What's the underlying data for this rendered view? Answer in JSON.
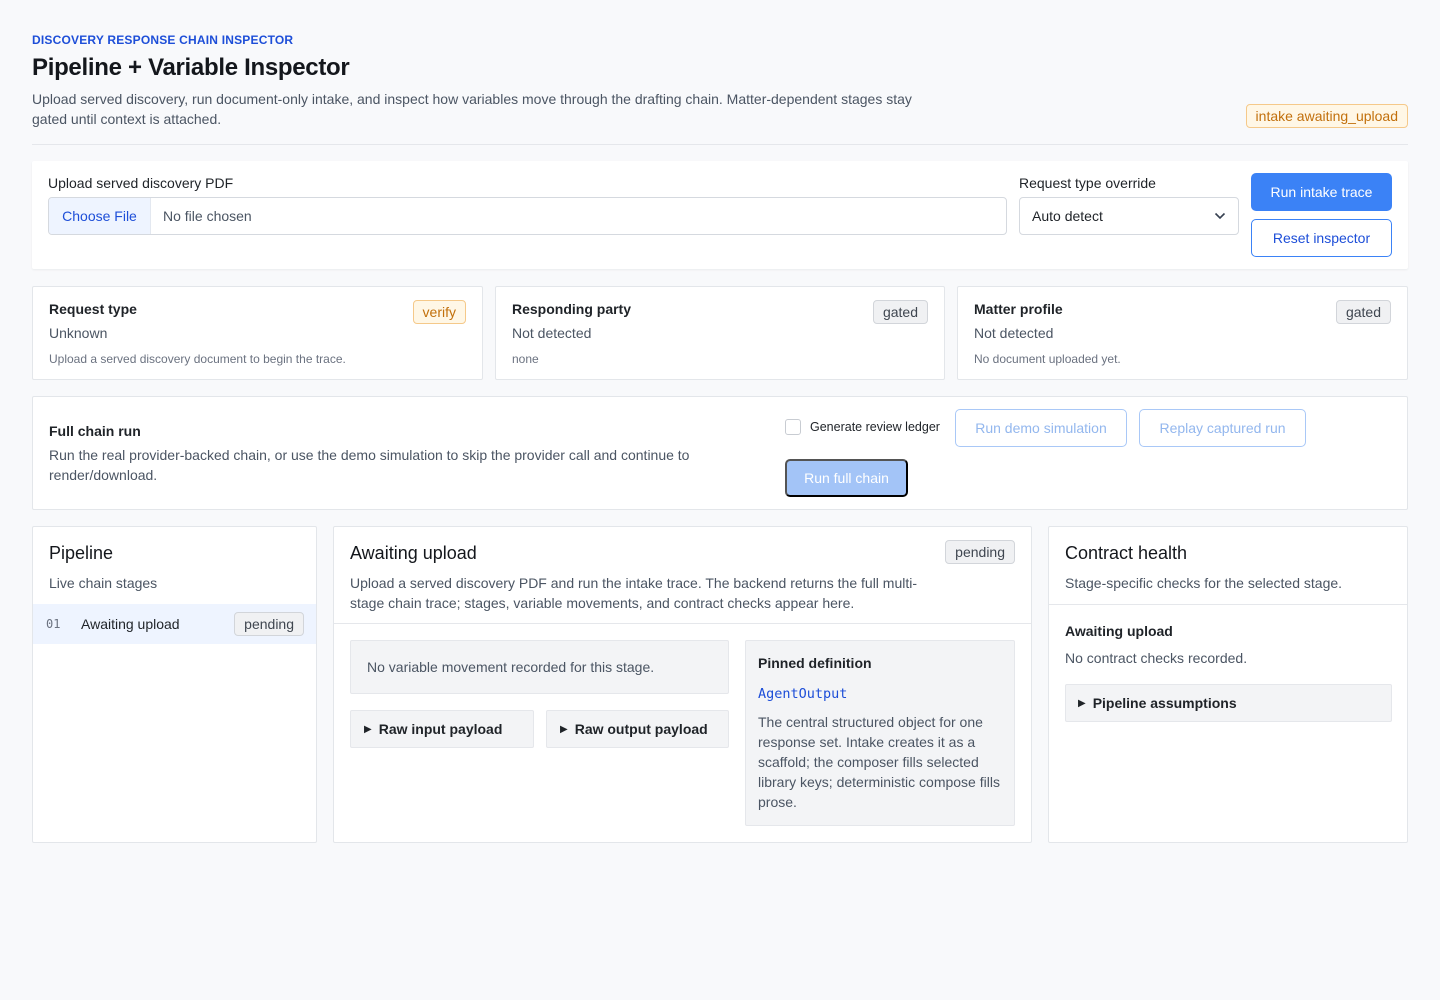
{
  "header": {
    "eyebrow": "DISCOVERY RESPONSE CHAIN INSPECTOR",
    "title": "Pipeline + Variable Inspector",
    "subtitle": "Upload served discovery, run document-only intake, and inspect how variables move through the drafting chain. Matter-dependent stages stay gated until context is attached.",
    "status_badge": "intake awaiting_upload"
  },
  "upload": {
    "file_label": "Upload served discovery PDF",
    "choose_file": "Choose File",
    "no_file": "No file chosen",
    "request_type_label": "Request type override",
    "request_type_value": "Auto detect",
    "run_intake": "Run intake trace",
    "reset": "Reset inspector"
  },
  "status_cards": [
    {
      "title": "Request type",
      "value": "Unknown",
      "note": "Upload a served discovery document to begin the trace.",
      "badge": "verify"
    },
    {
      "title": "Responding party",
      "value": "Not detected",
      "note": "none",
      "badge": "gated"
    },
    {
      "title": "Matter profile",
      "value": "Not detected",
      "note": "No document uploaded yet.",
      "badge": "gated"
    }
  ],
  "chain": {
    "title": "Full chain run",
    "description": "Run the real provider-backed chain, or use the demo simulation to skip the provider call and continue to render/download.",
    "ledger_label": "Generate review ledger",
    "demo_button": "Run demo simulation",
    "replay_button": "Replay captured run",
    "full_button": "Run full chain"
  },
  "pipeline": {
    "title": "Pipeline",
    "subtitle": "Live chain stages",
    "stages": [
      {
        "num": "01",
        "label": "Awaiting upload",
        "status": "pending"
      }
    ]
  },
  "stage_detail": {
    "title": "Awaiting upload",
    "status": "pending",
    "description": "Upload a served discovery PDF and run the intake trace. The backend returns the full multi-stage chain trace; stages, variable movements, and contract checks appear here.",
    "no_movement": "No variable movement recorded for this stage.",
    "raw_input": "Raw input payload",
    "raw_output": "Raw output payload",
    "pinned_title": "Pinned definition",
    "pinned_code": "AgentOutput",
    "pinned_body": "The central structured object for one response set. Intake creates it as a scaffold; the composer fills selected library keys; deterministic compose fills prose."
  },
  "health": {
    "title": "Contract health",
    "subtitle": "Stage-specific checks for the selected stage.",
    "stage": "Awaiting upload",
    "none": "No contract checks recorded.",
    "assumptions": "Pipeline assumptions"
  },
  "icons": {
    "select_caret": "chevron-down-icon",
    "details_toggle": "triangle-right-icon"
  },
  "colors": {
    "accent": "#3b82f6",
    "accent_dark": "#1d4ed8",
    "warn": "#c2700c"
  }
}
